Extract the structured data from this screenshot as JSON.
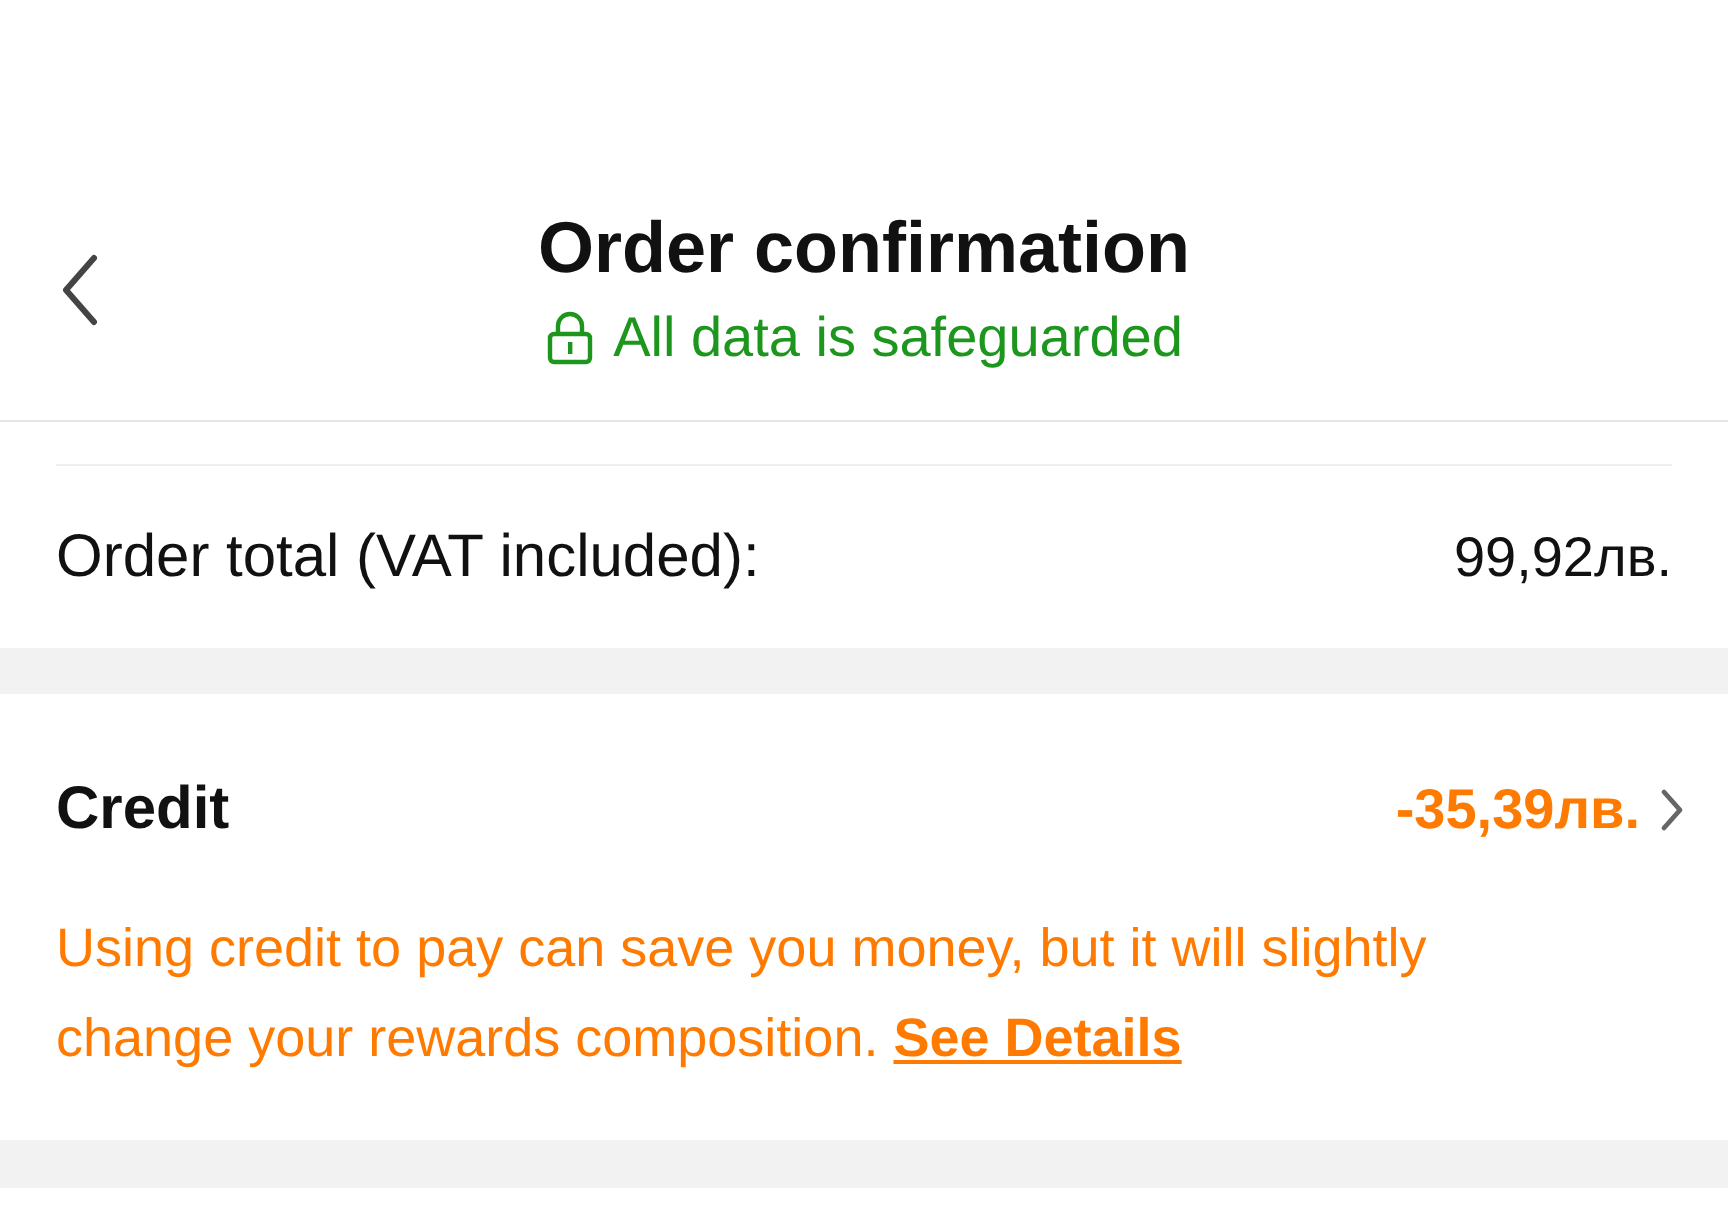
{
  "header": {
    "title": "Order confirmation",
    "security_note": "All data is safeguarded"
  },
  "order_total": {
    "label": "Order total (VAT included):",
    "value": "99,92лв."
  },
  "credit": {
    "label": "Credit",
    "value": "-35,39лв.",
    "note": "Using credit to pay can save you money, but it will slightly change your rewards composition.",
    "link": "See Details"
  }
}
